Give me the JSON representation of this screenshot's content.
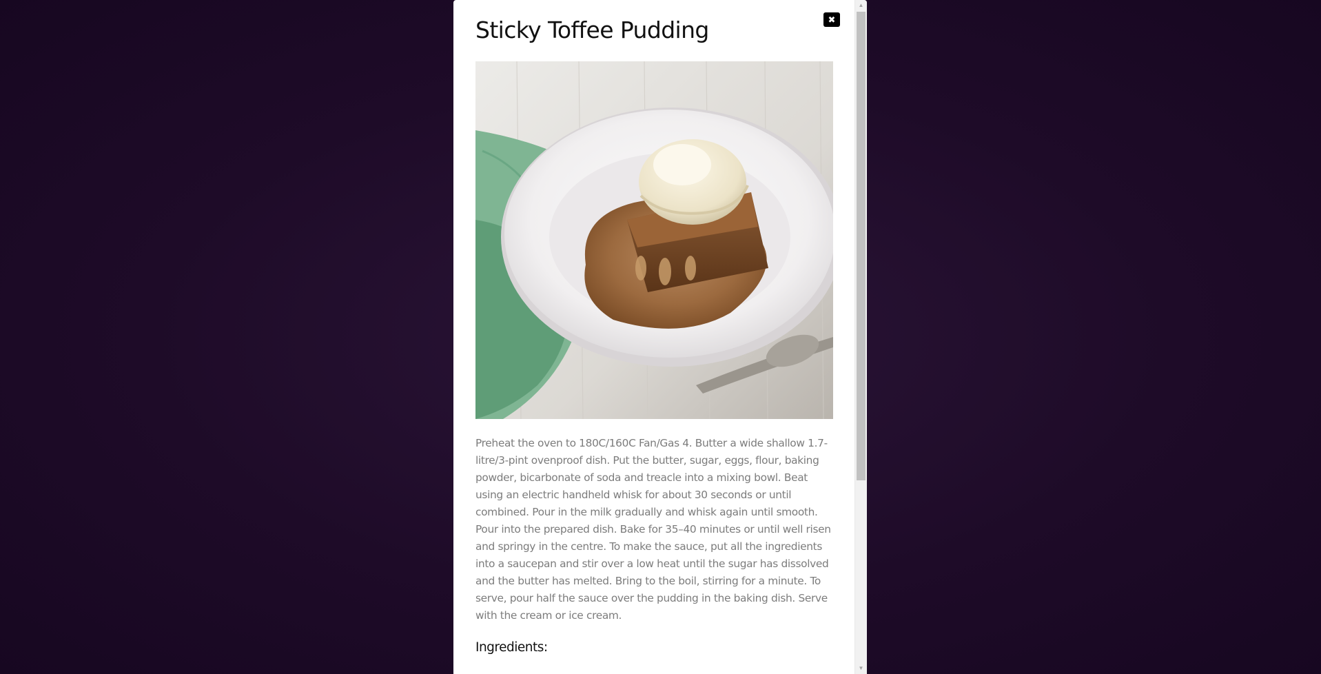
{
  "modal": {
    "title": "Sticky Toffee Pudding",
    "close_icon": "close-icon",
    "close_glyph": "✖",
    "image_alt": "Sticky toffee pudding with toffee sauce and ice cream on a white plate",
    "instructions": "Preheat the oven to 180C/160C Fan/Gas 4. Butter a wide shallow 1.7-litre/3-pint ovenproof dish. Put the butter, sugar, eggs, flour, baking powder, bicarbonate of soda and treacle into a mixing bowl. Beat using an electric handheld whisk for about 30 seconds or until combined. Pour in the milk gradually and whisk again until smooth. Pour into the prepared dish. Bake for 35–40 minutes or until well risen and springy in the centre. To make the sauce, put all the ingredients into a saucepan and stir over a low heat until the sugar has dissolved and the butter has melted. Bring to the boil, stirring for a minute. To serve, pour half the sauce over the pudding in the baking dish. Serve with the cream or ice cream.",
    "ingredients_heading": "Ingredients:"
  },
  "scrollbar": {
    "up_glyph": "▲",
    "down_glyph": "▼",
    "visible_fraction": 0.72
  },
  "colors": {
    "backdrop": "#1e0b28",
    "modal_bg": "#ffffff",
    "text_primary": "#111111",
    "text_secondary": "#7c7c7c",
    "close_bg": "#000000"
  }
}
